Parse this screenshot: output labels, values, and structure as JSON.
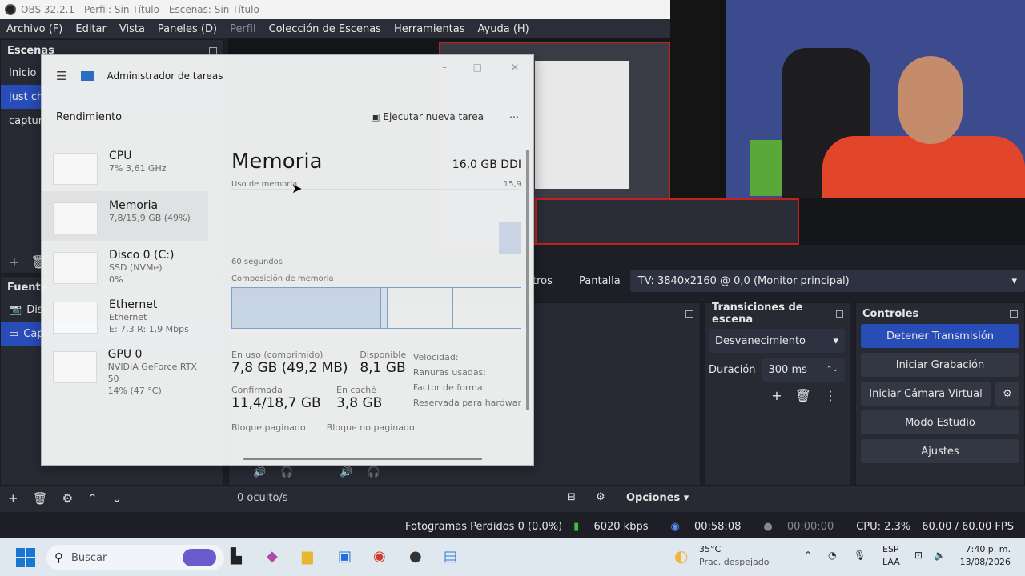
{
  "obs": {
    "title": "OBS 32.2.1 - Perfil: Sin Título - Escenas: Sin Título",
    "menu": [
      {
        "label": "Archivo (F)",
        "dim": false
      },
      {
        "label": "Editar",
        "dim": false
      },
      {
        "label": "Vista",
        "dim": false
      },
      {
        "label": "Paneles (D)",
        "dim": false
      },
      {
        "label": "Perfil",
        "dim": true
      },
      {
        "label": "Colección de Escenas",
        "dim": false
      },
      {
        "label": "Herramientas",
        "dim": false
      },
      {
        "label": "Ayuda (H)",
        "dim": false
      }
    ],
    "scenes": {
      "title": "Escenas",
      "items": [
        "Inicio",
        "just ch",
        "captur"
      ],
      "selected_index": 1
    },
    "sources": {
      "title": "Fuente",
      "items": [
        "Dis",
        "Cap"
      ],
      "selected_index": 1
    },
    "source_bar": {
      "filters_partial": "tros",
      "label": "Pantalla",
      "value": "TV: 3840x2160 @ 0,0 (Monitor principal)"
    },
    "transitions": {
      "title": "Transiciones de escena",
      "type": "Desvanecimiento",
      "duration_label": "Duración",
      "duration_value": "300 ms"
    },
    "controls": {
      "title": "Controles",
      "buttons": [
        "Detener Transmisión",
        "Iniciar Grabación",
        "Iniciar Cámara Virtual",
        "Modo Estudio",
        "Ajustes"
      ]
    },
    "mixer_bottom": {
      "hidden": "0 oculto/s",
      "options": "Opciones"
    },
    "status": {
      "dropped": "Fotogramas Perdidos 0 (0.0%)",
      "bitrate": "6020 kbps",
      "stream_time": "00:58:08",
      "rec_time": "00:00:00",
      "cpu": "CPU: 2.3%",
      "fps": "60.00 / 60.00 FPS"
    }
  },
  "task_manager": {
    "title": "Administrador de tareas",
    "section": "Rendimiento",
    "run_task": "Ejecutar nueva tarea",
    "items": [
      {
        "name": "CPU",
        "line1": "7% 3,61 GHz",
        "line2": ""
      },
      {
        "name": "Memoria",
        "line1": "7,8/15,9 GB (49%)",
        "line2": ""
      },
      {
        "name": "Disco 0 (C:)",
        "line1": "SSD (NVMe)",
        "line2": "0%"
      },
      {
        "name": "Ethernet",
        "line1": "Ethernet",
        "line2": "E: 7,3 R: 1,9 Mbps"
      },
      {
        "name": "GPU 0",
        "line1": "NVIDIA GeForce RTX 50",
        "line2": "14% (47 °C)"
      }
    ],
    "detail": {
      "heading": "Memoria",
      "capacity": "16,0 GB DDI",
      "usage_label": "Uso de memoria",
      "usage_max": "15,9",
      "seconds": "60 segundos",
      "composition": "Composición de memoria",
      "in_use_label": "En uso (comprimido)",
      "in_use_value": "7,8 GB (49,2 MB)",
      "available_label": "Disponible",
      "available_value": "8,1 GB",
      "speed": "Velocidad:",
      "slots": "Ranuras usadas:",
      "form": "Factor de forma:",
      "reserved": "Reservada para hardwar",
      "committed_label": "Confirmada",
      "committed_value": "11,4/18,7 GB",
      "cached_label": "En caché",
      "cached_value": "3,8 GB",
      "paged": "Bloque paginado",
      "nonpaged": "Bloque no paginado"
    }
  },
  "taskbar": {
    "search": "Buscar",
    "weather_temp": "35°C",
    "weather_desc": "Prac. despejado",
    "lang1": "ESP",
    "lang2": "LAA",
    "time": "7:40 p. m.",
    "date": "13/08/2026"
  }
}
